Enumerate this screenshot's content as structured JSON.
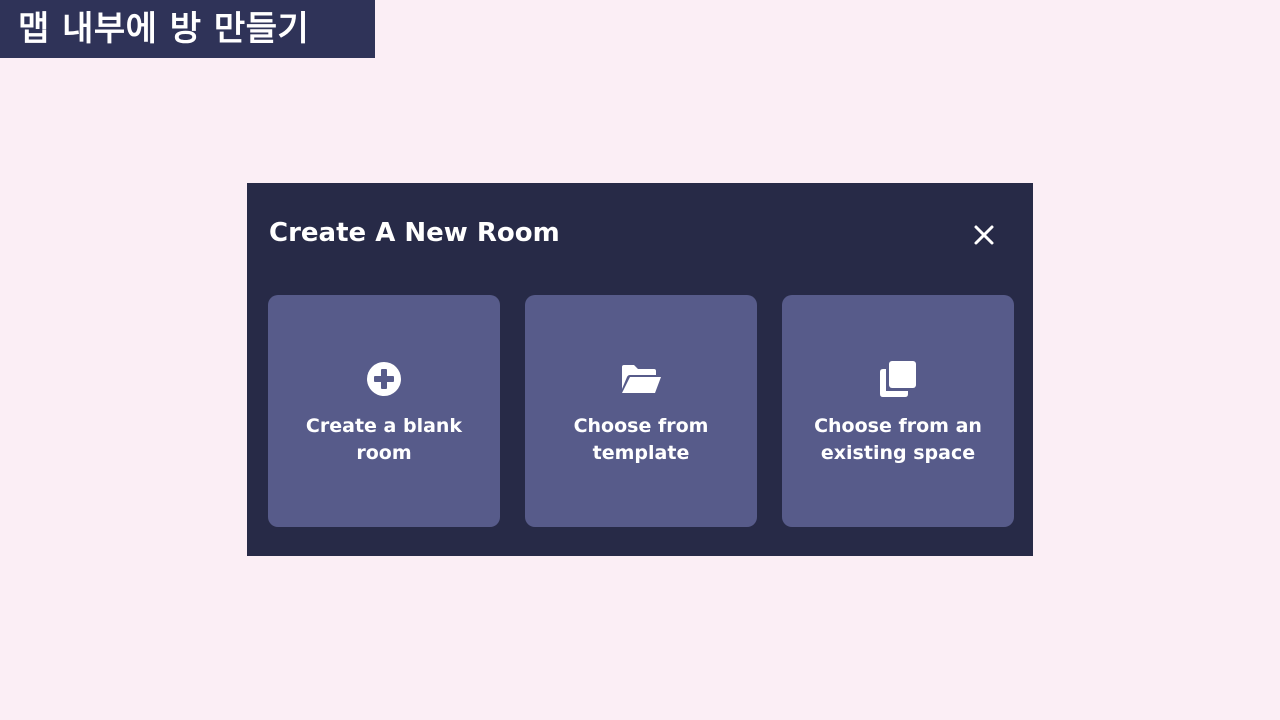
{
  "banner": {
    "text": "맵 내부에 방 만들기"
  },
  "modal": {
    "title": "Create A New Room",
    "close_icon": "close-icon",
    "options": [
      {
        "label": "Create a blank room",
        "icon": "plus-circle-icon"
      },
      {
        "label": "Choose from template",
        "icon": "folder-open-icon"
      },
      {
        "label": "Choose from an existing space",
        "icon": "copy-icon"
      }
    ]
  },
  "colors": {
    "page_background": "#fbeef5",
    "banner_background": "#2f3358",
    "modal_background": "#272a47",
    "card_background": "#575b8a",
    "text": "#ffffff"
  }
}
